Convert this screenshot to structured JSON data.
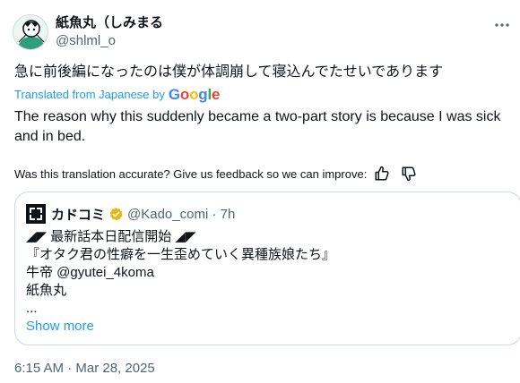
{
  "author": {
    "display_name": "紙魚丸（しみまる",
    "handle": "@shlml_o",
    "avatar_icon": "user-avatar-illustration"
  },
  "post": {
    "original_text": "急に前後編になったのは僕が体調崩して寝込んでたせいであります",
    "translated_from": "Translated from Japanese by",
    "translator_brand": "Google",
    "translation": "The reason why this suddenly became a two-part story is because I was sick and in bed.",
    "timestamp": "6:15 AM · Mar 28, 2025"
  },
  "feedback": {
    "prompt": "Was this translation accurate? Give us feedback so we can improve:",
    "thumbs_up_icon": "thumbs-up-icon",
    "thumbs_down_icon": "thumbs-down-icon"
  },
  "quoted_post": {
    "display_name": "カドコミ",
    "handle_time": "@Kado_comi · 7h",
    "verified_icon": "gold-verified-badge",
    "lines": [
      "◢◤ 最新話本日配信開始 ◢◤",
      "『オタク君の性癖を一生歪めていく異種族娘たち』",
      "牛帝 @gyutei_4koma",
      "紙魚丸",
      "..."
    ],
    "show_more": "Show more"
  },
  "colors": {
    "link": "#1d9bf0",
    "secondary_text": "#536471",
    "verified_gold": "#e2b719",
    "border": "#cfd9de"
  }
}
